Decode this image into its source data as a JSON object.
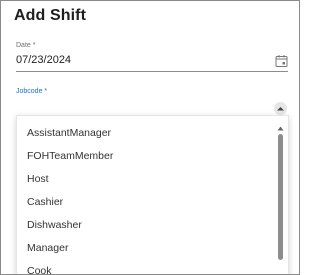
{
  "dialog": {
    "title": "Add Shift"
  },
  "date_field": {
    "label": "Date *",
    "value": "07/23/2024",
    "icon": "calendar-icon"
  },
  "jobcode_field": {
    "label": "Jobcode *",
    "value": "",
    "icon": "chevron-up-icon",
    "accent_color": "#2b7bd0"
  },
  "jobcode_options": [
    "AssistantManager",
    "FOHTeamMember",
    "Host",
    "Cashier",
    "Dishwasher",
    "Manager",
    "Cook"
  ]
}
